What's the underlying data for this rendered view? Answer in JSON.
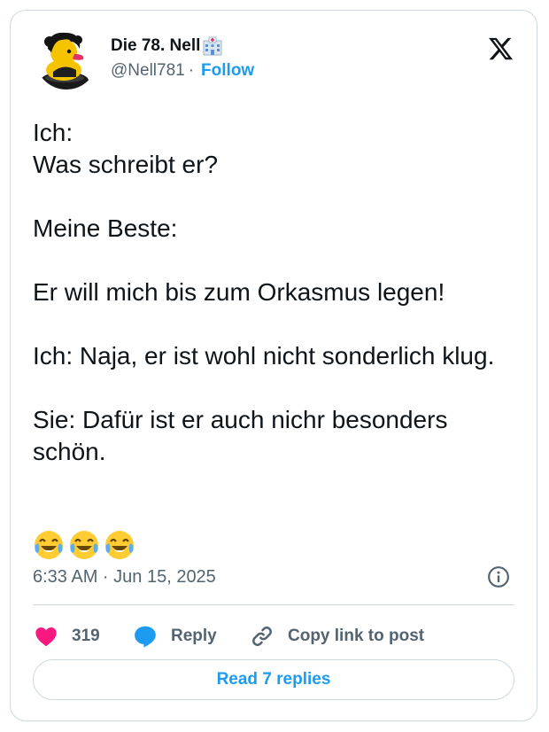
{
  "author": {
    "name": "Die 78. Nell",
    "handle": "@Nell781",
    "separator": "·",
    "follow_label": "Follow"
  },
  "icons": {
    "brand": "x-logo",
    "name_badge": "hospital-emoji",
    "emoji": "face-with-tears-of-joy",
    "info": "info-icon"
  },
  "tweet": {
    "lines": [
      "Ich:",
      "Was schreibt er?",
      "",
      "Meine Beste:",
      "",
      "Er will mich bis zum Orkasmus legen!",
      "",
      "Ich: Naja, er ist wohl nicht sonderlich klug.",
      "",
      "Sie: Dafür ist er auch nichr besonders schön."
    ],
    "emoji_count": 3,
    "timestamp": "6:33 AM · Jun 15, 2025"
  },
  "actions": {
    "likes": "319",
    "reply_label": "Reply",
    "copy_label": "Copy link to post",
    "read_replies_label": "Read 7 replies"
  },
  "colors": {
    "accent": "#1d9bf0",
    "heart": "#f91880",
    "text": "#0f1419",
    "muted": "#536471",
    "border": "#cfd9de"
  }
}
